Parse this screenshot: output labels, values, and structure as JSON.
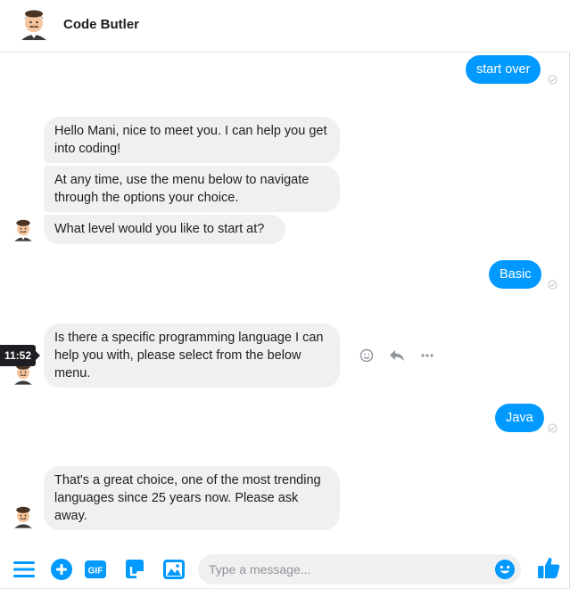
{
  "header": {
    "title": "Code Butler",
    "avatar_icon": "butler-avatar"
  },
  "messages": {
    "m1": "start over",
    "m2": "Hello Mani, nice to meet you. I can help you get into coding!",
    "m3": "At any time, use the menu below to navigate through the options your choice.",
    "m4": "What level would you like to start at?",
    "m5": "Basic",
    "m6": "Is there a specific programming language I can help you with, please select from the below menu.",
    "m7": "Java",
    "m8": "That's a great choice, one of the most trending languages since 25 years now. Please ask away."
  },
  "tooltip": {
    "time": "11:52"
  },
  "composer": {
    "placeholder": "Type a message...",
    "value": ""
  },
  "colors": {
    "accent": "#0099ff",
    "bubble_in": "#f1f0f0"
  },
  "icons": [
    "menu-icon",
    "plus-icon",
    "gif-icon",
    "sticker-icon",
    "image-icon",
    "emoji-icon",
    "like-icon",
    "reply-icon",
    "more-icon",
    "seen-check-icon"
  ]
}
